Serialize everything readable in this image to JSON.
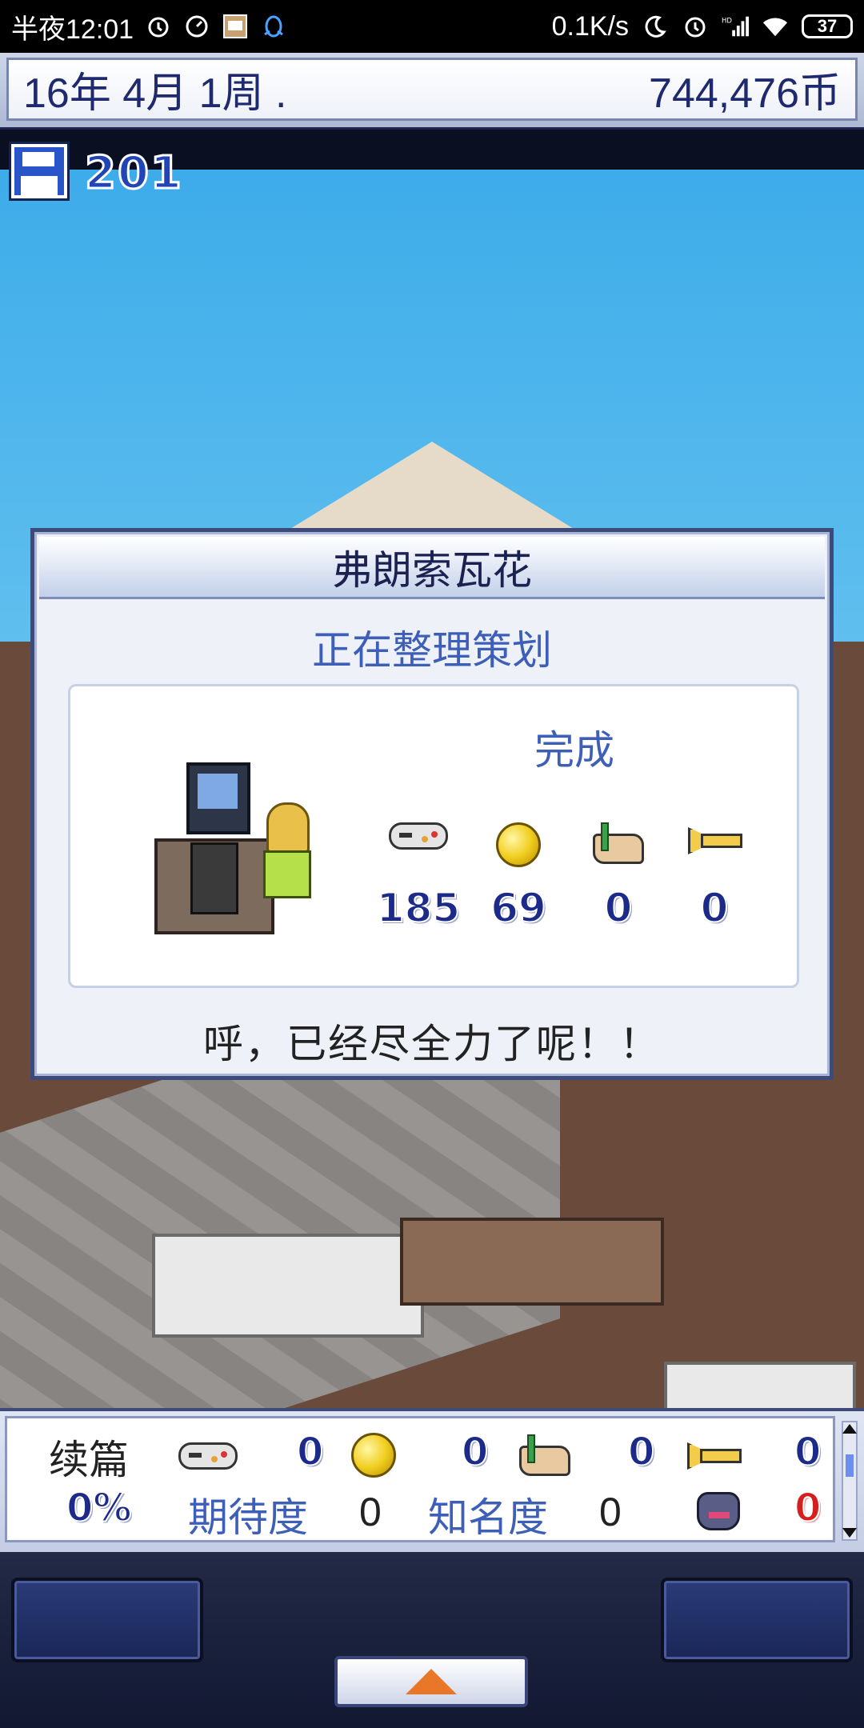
{
  "status_bar": {
    "time": "半夜12:01",
    "net_speed": "0.1K/s",
    "battery": "37",
    "network_badge": "HD",
    "icons": [
      "alarm-icon",
      "speedometer-icon",
      "app-thumbnail-icon",
      "qq-penguin-icon",
      "moon-icon",
      "alarm-icon",
      "signal-icon",
      "wifi-icon",
      "battery-icon"
    ]
  },
  "topbar": {
    "date": "16年 4月 1周 .",
    "money": "744,476币"
  },
  "save": {
    "icon": "floppy-disk-icon",
    "count": "201"
  },
  "dialog": {
    "title": "弗朗索瓦花",
    "status": "正在整理策划",
    "done_label": "完成",
    "stats": [
      {
        "icon": "gamepad-icon",
        "value": "185"
      },
      {
        "icon": "coin-icon",
        "value": "69"
      },
      {
        "icon": "palette-icon",
        "value": "0"
      },
      {
        "icon": "trumpet-icon",
        "value": "0"
      }
    ],
    "message": "呼，已经尽全力了呢！！"
  },
  "bottom_panel": {
    "title": "续篇",
    "stats": [
      {
        "icon": "gamepad-icon",
        "value": "0"
      },
      {
        "icon": "coin-icon",
        "value": "0"
      },
      {
        "icon": "palette-icon",
        "value": "0"
      },
      {
        "icon": "trumpet-icon",
        "value": "0"
      }
    ],
    "percent": "0%",
    "expectation_label": "期待度",
    "expectation_value": "0",
    "fame_label": "知名度",
    "fame_value": "0",
    "bug_icon": "monster-icon",
    "bug_value": "0"
  },
  "colors": {
    "accent": "#3d5fb8",
    "stat_value": "#1c2a8a",
    "bug_value": "#d51f1f",
    "arrow": "#e8772a"
  }
}
